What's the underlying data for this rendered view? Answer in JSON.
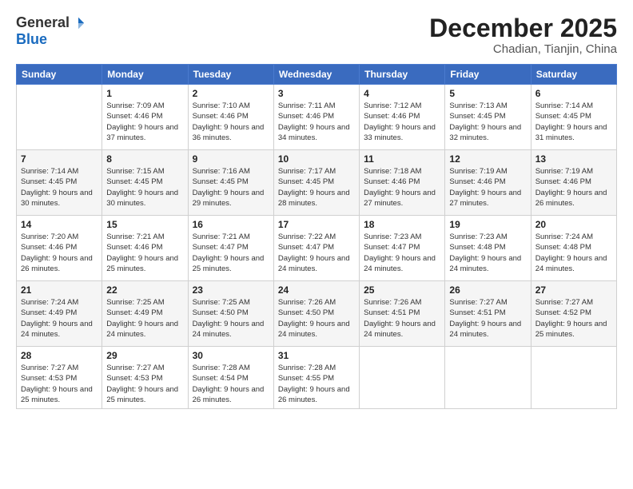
{
  "logo": {
    "general": "General",
    "blue": "Blue"
  },
  "title": "December 2025",
  "subtitle": "Chadian, Tianjin, China",
  "weekdays": [
    "Sunday",
    "Monday",
    "Tuesday",
    "Wednesday",
    "Thursday",
    "Friday",
    "Saturday"
  ],
  "weeks": [
    [
      {
        "day": "",
        "sunrise": "",
        "sunset": "",
        "daylight": ""
      },
      {
        "day": "1",
        "sunrise": "Sunrise: 7:09 AM",
        "sunset": "Sunset: 4:46 PM",
        "daylight": "Daylight: 9 hours and 37 minutes."
      },
      {
        "day": "2",
        "sunrise": "Sunrise: 7:10 AM",
        "sunset": "Sunset: 4:46 PM",
        "daylight": "Daylight: 9 hours and 36 minutes."
      },
      {
        "day": "3",
        "sunrise": "Sunrise: 7:11 AM",
        "sunset": "Sunset: 4:46 PM",
        "daylight": "Daylight: 9 hours and 34 minutes."
      },
      {
        "day": "4",
        "sunrise": "Sunrise: 7:12 AM",
        "sunset": "Sunset: 4:46 PM",
        "daylight": "Daylight: 9 hours and 33 minutes."
      },
      {
        "day": "5",
        "sunrise": "Sunrise: 7:13 AM",
        "sunset": "Sunset: 4:45 PM",
        "daylight": "Daylight: 9 hours and 32 minutes."
      },
      {
        "day": "6",
        "sunrise": "Sunrise: 7:14 AM",
        "sunset": "Sunset: 4:45 PM",
        "daylight": "Daylight: 9 hours and 31 minutes."
      }
    ],
    [
      {
        "day": "7",
        "sunrise": "Sunrise: 7:14 AM",
        "sunset": "Sunset: 4:45 PM",
        "daylight": "Daylight: 9 hours and 30 minutes."
      },
      {
        "day": "8",
        "sunrise": "Sunrise: 7:15 AM",
        "sunset": "Sunset: 4:45 PM",
        "daylight": "Daylight: 9 hours and 30 minutes."
      },
      {
        "day": "9",
        "sunrise": "Sunrise: 7:16 AM",
        "sunset": "Sunset: 4:45 PM",
        "daylight": "Daylight: 9 hours and 29 minutes."
      },
      {
        "day": "10",
        "sunrise": "Sunrise: 7:17 AM",
        "sunset": "Sunset: 4:45 PM",
        "daylight": "Daylight: 9 hours and 28 minutes."
      },
      {
        "day": "11",
        "sunrise": "Sunrise: 7:18 AM",
        "sunset": "Sunset: 4:46 PM",
        "daylight": "Daylight: 9 hours and 27 minutes."
      },
      {
        "day": "12",
        "sunrise": "Sunrise: 7:19 AM",
        "sunset": "Sunset: 4:46 PM",
        "daylight": "Daylight: 9 hours and 27 minutes."
      },
      {
        "day": "13",
        "sunrise": "Sunrise: 7:19 AM",
        "sunset": "Sunset: 4:46 PM",
        "daylight": "Daylight: 9 hours and 26 minutes."
      }
    ],
    [
      {
        "day": "14",
        "sunrise": "Sunrise: 7:20 AM",
        "sunset": "Sunset: 4:46 PM",
        "daylight": "Daylight: 9 hours and 26 minutes."
      },
      {
        "day": "15",
        "sunrise": "Sunrise: 7:21 AM",
        "sunset": "Sunset: 4:46 PM",
        "daylight": "Daylight: 9 hours and 25 minutes."
      },
      {
        "day": "16",
        "sunrise": "Sunrise: 7:21 AM",
        "sunset": "Sunset: 4:47 PM",
        "daylight": "Daylight: 9 hours and 25 minutes."
      },
      {
        "day": "17",
        "sunrise": "Sunrise: 7:22 AM",
        "sunset": "Sunset: 4:47 PM",
        "daylight": "Daylight: 9 hours and 24 minutes."
      },
      {
        "day": "18",
        "sunrise": "Sunrise: 7:23 AM",
        "sunset": "Sunset: 4:47 PM",
        "daylight": "Daylight: 9 hours and 24 minutes."
      },
      {
        "day": "19",
        "sunrise": "Sunrise: 7:23 AM",
        "sunset": "Sunset: 4:48 PM",
        "daylight": "Daylight: 9 hours and 24 minutes."
      },
      {
        "day": "20",
        "sunrise": "Sunrise: 7:24 AM",
        "sunset": "Sunset: 4:48 PM",
        "daylight": "Daylight: 9 hours and 24 minutes."
      }
    ],
    [
      {
        "day": "21",
        "sunrise": "Sunrise: 7:24 AM",
        "sunset": "Sunset: 4:49 PM",
        "daylight": "Daylight: 9 hours and 24 minutes."
      },
      {
        "day": "22",
        "sunrise": "Sunrise: 7:25 AM",
        "sunset": "Sunset: 4:49 PM",
        "daylight": "Daylight: 9 hours and 24 minutes."
      },
      {
        "day": "23",
        "sunrise": "Sunrise: 7:25 AM",
        "sunset": "Sunset: 4:50 PM",
        "daylight": "Daylight: 9 hours and 24 minutes."
      },
      {
        "day": "24",
        "sunrise": "Sunrise: 7:26 AM",
        "sunset": "Sunset: 4:50 PM",
        "daylight": "Daylight: 9 hours and 24 minutes."
      },
      {
        "day": "25",
        "sunrise": "Sunrise: 7:26 AM",
        "sunset": "Sunset: 4:51 PM",
        "daylight": "Daylight: 9 hours and 24 minutes."
      },
      {
        "day": "26",
        "sunrise": "Sunrise: 7:27 AM",
        "sunset": "Sunset: 4:51 PM",
        "daylight": "Daylight: 9 hours and 24 minutes."
      },
      {
        "day": "27",
        "sunrise": "Sunrise: 7:27 AM",
        "sunset": "Sunset: 4:52 PM",
        "daylight": "Daylight: 9 hours and 25 minutes."
      }
    ],
    [
      {
        "day": "28",
        "sunrise": "Sunrise: 7:27 AM",
        "sunset": "Sunset: 4:53 PM",
        "daylight": "Daylight: 9 hours and 25 minutes."
      },
      {
        "day": "29",
        "sunrise": "Sunrise: 7:27 AM",
        "sunset": "Sunset: 4:53 PM",
        "daylight": "Daylight: 9 hours and 25 minutes."
      },
      {
        "day": "30",
        "sunrise": "Sunrise: 7:28 AM",
        "sunset": "Sunset: 4:54 PM",
        "daylight": "Daylight: 9 hours and 26 minutes."
      },
      {
        "day": "31",
        "sunrise": "Sunrise: 7:28 AM",
        "sunset": "Sunset: 4:55 PM",
        "daylight": "Daylight: 9 hours and 26 minutes."
      },
      {
        "day": "",
        "sunrise": "",
        "sunset": "",
        "daylight": ""
      },
      {
        "day": "",
        "sunrise": "",
        "sunset": "",
        "daylight": ""
      },
      {
        "day": "",
        "sunrise": "",
        "sunset": "",
        "daylight": ""
      }
    ]
  ]
}
